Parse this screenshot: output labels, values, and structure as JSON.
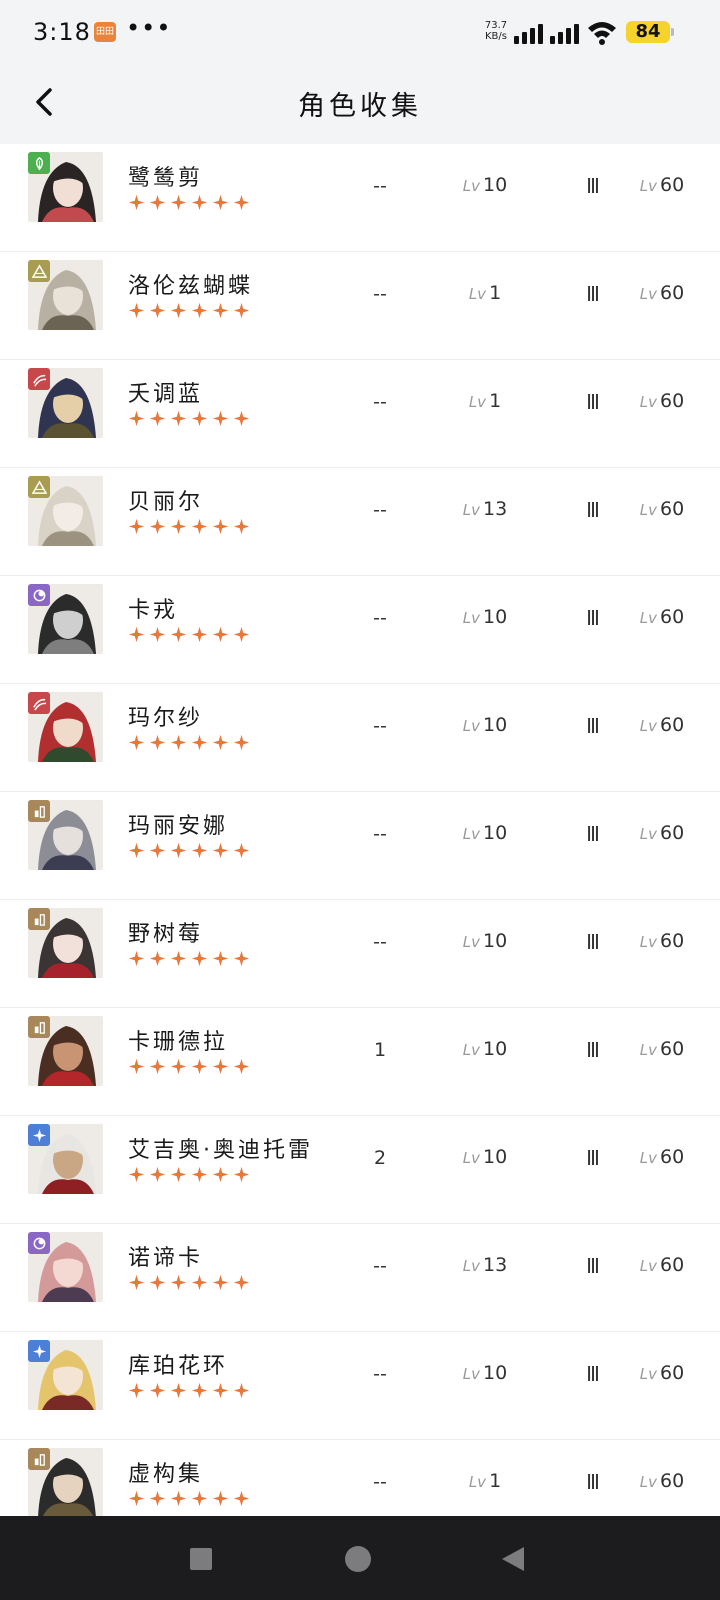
{
  "status_bar": {
    "time": "3:18",
    "app_badge": "田田",
    "more": "•••",
    "net_speed_value": "73.7",
    "net_speed_unit": "KB/s",
    "battery": "84"
  },
  "header": {
    "title": "角色收集",
    "back_icon": "chevron-left-icon"
  },
  "colors": {
    "star": "#e8773a",
    "element_green": "#4caf50",
    "element_olive": "#a89b52",
    "element_red": "#c8474a",
    "element_purple": "#8a67c4",
    "element_brown": "#a8875a",
    "element_blue": "#4d7fd6"
  },
  "characters": [
    {
      "name": "鹭鸶剪",
      "element": "leaf-icon",
      "element_color": "#4caf50",
      "stars": 6,
      "resonance": "--",
      "level_prefix": "Lv",
      "level": "10",
      "tier": "Ⅲ",
      "max_prefix": "Lv",
      "max_level": "60",
      "palette": [
        "#2a2424",
        "#f1ded4",
        "#c24a4f"
      ]
    },
    {
      "name": "洛伦兹蝴蝶",
      "element": "mountain-icon",
      "element_color": "#a89b52",
      "stars": 6,
      "resonance": "--",
      "level_prefix": "Lv",
      "level": "1",
      "tier": "Ⅲ",
      "max_prefix": "Lv",
      "max_level": "60",
      "palette": [
        "#b8b0a2",
        "#e9e2d8",
        "#6b6455"
      ]
    },
    {
      "name": "夭调蓝",
      "element": "wave-icon",
      "element_color": "#c8474a",
      "stars": 6,
      "resonance": "--",
      "level_prefix": "Lv",
      "level": "1",
      "tier": "Ⅲ",
      "max_prefix": "Lv",
      "max_level": "60",
      "palette": [
        "#2f3550",
        "#e5cfa8",
        "#5a5230"
      ]
    },
    {
      "name": "贝丽尔",
      "element": "mountain-icon",
      "element_color": "#a89b52",
      "stars": 6,
      "resonance": "--",
      "level_prefix": "Lv",
      "level": "13",
      "tier": "Ⅲ",
      "max_prefix": "Lv",
      "max_level": "60",
      "palette": [
        "#d9d2c6",
        "#f3ece6",
        "#9c9280"
      ]
    },
    {
      "name": "卡戎",
      "element": "moon-icon",
      "element_color": "#8a67c4",
      "stars": 6,
      "resonance": "--",
      "level_prefix": "Lv",
      "level": "10",
      "tier": "Ⅲ",
      "max_prefix": "Lv",
      "max_level": "60",
      "palette": [
        "#2b2b2b",
        "#cfcfcf",
        "#7e7e7e"
      ]
    },
    {
      "name": "玛尔纱",
      "element": "wave-icon",
      "element_color": "#c8474a",
      "stars": 6,
      "resonance": "--",
      "level_prefix": "Lv",
      "level": "10",
      "tier": "Ⅲ",
      "max_prefix": "Lv",
      "max_level": "60",
      "palette": [
        "#b22f30",
        "#f0dac9",
        "#2f4a2d"
      ]
    },
    {
      "name": "玛丽安娜",
      "element": "tower-icon",
      "element_color": "#a8875a",
      "stars": 6,
      "resonance": "--",
      "level_prefix": "Lv",
      "level": "10",
      "tier": "Ⅲ",
      "max_prefix": "Lv",
      "max_level": "60",
      "palette": [
        "#8d8d95",
        "#e6e0dc",
        "#3c3c52"
      ]
    },
    {
      "name": "野树莓",
      "element": "tower-icon",
      "element_color": "#a8875a",
      "stars": 6,
      "resonance": "--",
      "level_prefix": "Lv",
      "level": "10",
      "tier": "Ⅲ",
      "max_prefix": "Lv",
      "max_level": "60",
      "palette": [
        "#3a3434",
        "#f1e1da",
        "#a6232b"
      ]
    },
    {
      "name": "卡珊德拉",
      "element": "tower-icon",
      "element_color": "#a8875a",
      "stars": 6,
      "resonance": "1",
      "level_prefix": "Lv",
      "level": "10",
      "tier": "Ⅲ",
      "max_prefix": "Lv",
      "max_level": "60",
      "palette": [
        "#4a2e22",
        "#c89473",
        "#b3262a"
      ]
    },
    {
      "name": "艾吉奥·奥迪托雷",
      "element": "star-icon",
      "element_color": "#4d7fd6",
      "stars": 6,
      "resonance": "2",
      "level_prefix": "Lv",
      "level": "10",
      "tier": "Ⅲ",
      "max_prefix": "Lv",
      "max_level": "60",
      "palette": [
        "#e8e6e3",
        "#caa784",
        "#8e1f22"
      ]
    },
    {
      "name": "诺谛卡",
      "element": "moon-icon",
      "element_color": "#8a67c4",
      "stars": 6,
      "resonance": "--",
      "level_prefix": "Lv",
      "level": "13",
      "tier": "Ⅲ",
      "max_prefix": "Lv",
      "max_level": "60",
      "palette": [
        "#d49a9a",
        "#f4d8d2",
        "#4d3b52"
      ]
    },
    {
      "name": "库珀花环",
      "element": "star-icon",
      "element_color": "#4d7fd6",
      "stars": 6,
      "resonance": "--",
      "level_prefix": "Lv",
      "level": "10",
      "tier": "Ⅲ",
      "max_prefix": "Lv",
      "max_level": "60",
      "palette": [
        "#e5c56c",
        "#f4e4d4",
        "#7a2a26"
      ]
    },
    {
      "name": "虚构集",
      "element": "tower-icon",
      "element_color": "#a8875a",
      "stars": 6,
      "resonance": "--",
      "level_prefix": "Lv",
      "level": "1",
      "tier": "Ⅲ",
      "max_prefix": "Lv",
      "max_level": "60",
      "palette": [
        "#2b2b2b",
        "#e6d3bf",
        "#6a5a3c"
      ]
    }
  ],
  "nav_bar": {
    "recents": "square-icon",
    "home": "circle-icon",
    "back": "triangle-back-icon"
  }
}
